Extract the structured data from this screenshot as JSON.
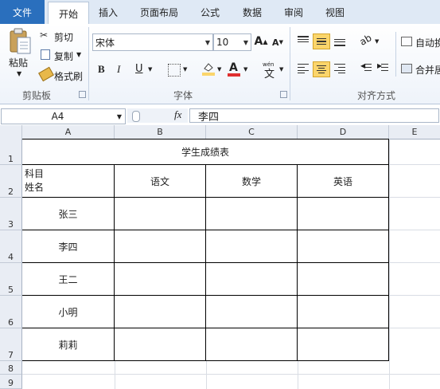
{
  "tabs": {
    "file": "文件",
    "home": "开始",
    "insert": "插入",
    "layout": "页面布局",
    "formula": "公式",
    "data": "数据",
    "review": "审阅",
    "view": "视图"
  },
  "clipboard": {
    "paste": "粘贴",
    "cut": "剪切",
    "copy": "复制",
    "painter": "格式刷",
    "group": "剪贴板"
  },
  "font": {
    "name": "宋体",
    "size": "10",
    "group": "字体",
    "bold": "B",
    "italic": "I",
    "underline": "U",
    "wen": "wén",
    "wen_char": "文"
  },
  "alignment": {
    "group": "对齐方式",
    "wrap": "自动换",
    "merge": "合并居"
  },
  "namebox": "A4",
  "formula_icon": "fx",
  "formula_value": "李四",
  "columns": [
    "A",
    "B",
    "C",
    "D",
    "E"
  ],
  "rows": [
    "1",
    "2",
    "3",
    "4",
    "5",
    "6",
    "7",
    "8",
    "9"
  ],
  "sheet": {
    "title": "学生成绩表",
    "corner_top": "科目",
    "corner_bottom": "姓名",
    "subjects": [
      "语文",
      "数学",
      "英语"
    ],
    "students": [
      "张三",
      "李四",
      "王二",
      "小明",
      "莉莉"
    ]
  },
  "colors": {
    "file_tab": "#2a6fbd",
    "highlight": "#fbd56b",
    "font_red": "#e03030"
  }
}
